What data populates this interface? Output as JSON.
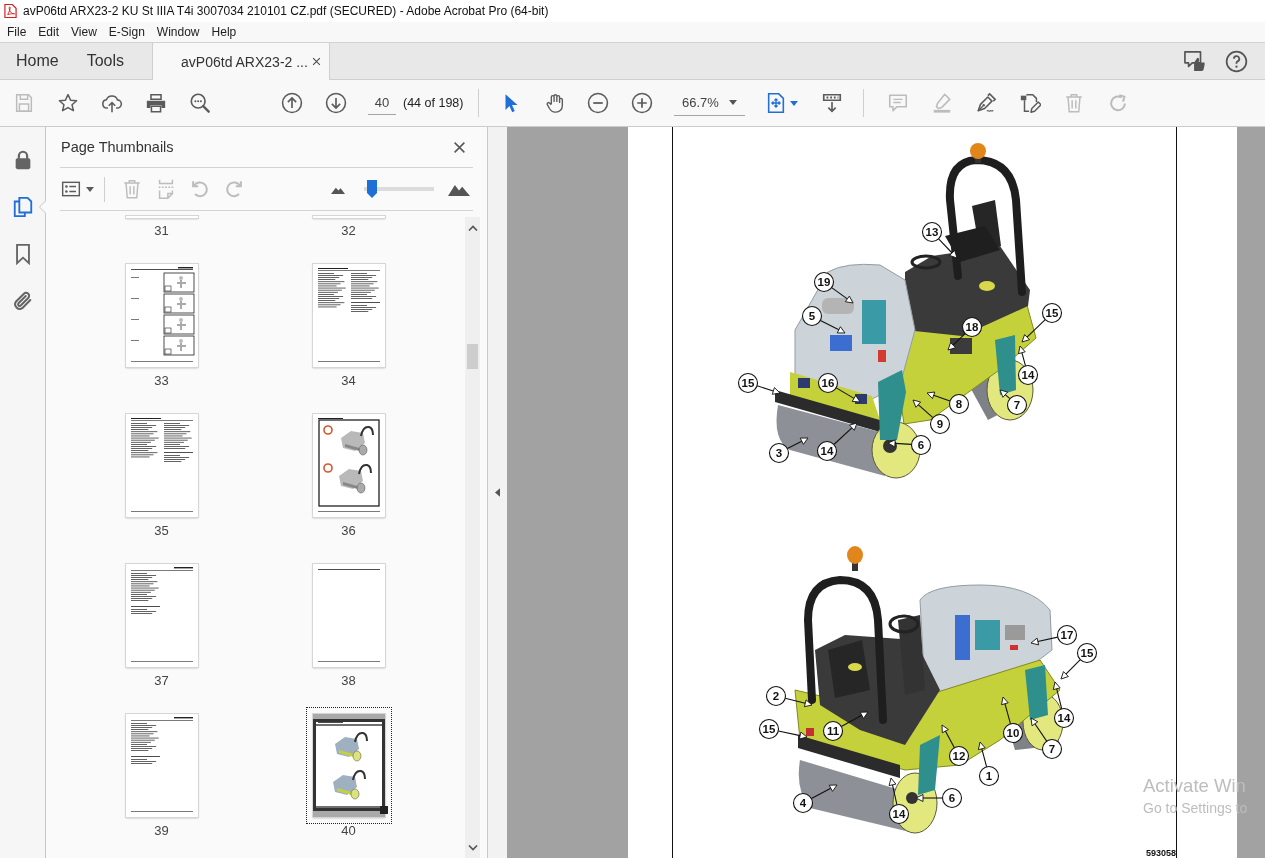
{
  "window": {
    "title": "avP06td ARX23-2 KU St IIIA T4i 3007034 210101 CZ.pdf (SECURED) - Adobe Acrobat Pro (64-bit)"
  },
  "menu": [
    "File",
    "Edit",
    "View",
    "E-Sign",
    "Window",
    "Help"
  ],
  "tabs": [
    {
      "label": "Home",
      "kind": "section",
      "selected": false
    },
    {
      "label": "Tools",
      "kind": "section",
      "selected": false
    },
    {
      "label": "avP06td ARX23-2 ...",
      "kind": "document",
      "selected": true
    }
  ],
  "toolbar": {
    "file_tools": [
      {
        "kind": "save",
        "disabled": true
      },
      {
        "kind": "star",
        "disabled": false
      },
      {
        "kind": "share",
        "disabled": false
      },
      {
        "kind": "print",
        "disabled": false
      },
      {
        "kind": "find",
        "disabled": false
      }
    ],
    "page_nav": [
      {
        "kind": "previous"
      },
      {
        "kind": "next"
      }
    ],
    "page_number": "40",
    "page_count": "(44 of 198)",
    "view_tools": [
      {
        "kind": "select",
        "selected": true
      },
      {
        "kind": "hand",
        "selected": false
      },
      {
        "kind": "zoom_out",
        "selected": false
      },
      {
        "kind": "zoom_in",
        "selected": false
      }
    ],
    "zoom": "66.7%",
    "page_tools": [
      {
        "kind": "organize",
        "selected": true
      },
      {
        "kind": "scroll",
        "selected": false
      }
    ],
    "edit_tools": [
      {
        "kind": "comment",
        "disabled": true
      },
      {
        "kind": "highlight",
        "disabled": true
      },
      {
        "kind": "sign",
        "disabled": false
      },
      {
        "kind": "edit",
        "disabled": false
      },
      {
        "kind": "delete",
        "disabled": true
      },
      {
        "kind": "rotate",
        "disabled": true
      }
    ]
  },
  "side_rail": [
    {
      "kind": "protect",
      "selected": false
    },
    {
      "kind": "pages",
      "selected": true
    },
    {
      "kind": "bookmarks",
      "selected": false
    },
    {
      "kind": "attachments",
      "selected": false
    }
  ],
  "thumbnails_panel": {
    "title": "Page Thumbnails",
    "tools": [
      {
        "kind": "options",
        "disabled": false
      },
      {
        "kind": "delete",
        "disabled": true
      },
      {
        "kind": "split",
        "disabled": true
      },
      {
        "kind": "rotate_left",
        "disabled": true
      },
      {
        "kind": "rotate_right",
        "disabled": true
      }
    ],
    "size_slider": {
      "level": 0.05
    },
    "pages": [
      {
        "label": "31",
        "kind": "cut",
        "selected": false
      },
      {
        "label": "32",
        "kind": "cut",
        "selected": false
      },
      {
        "label": "33",
        "kind": "signals",
        "selected": false
      },
      {
        "label": "34",
        "kind": "columns",
        "selected": false
      },
      {
        "label": "35",
        "kind": "columns",
        "selected": false
      },
      {
        "label": "36",
        "kind": "figure",
        "selected": false
      },
      {
        "label": "37",
        "kind": "text",
        "selected": false
      },
      {
        "label": "38",
        "kind": "blank",
        "selected": false
      },
      {
        "label": "39",
        "kind": "text",
        "selected": false
      },
      {
        "label": "40",
        "kind": "color_figure",
        "selected": true
      }
    ]
  },
  "document": {
    "figures": [
      {
        "callouts": [
          "13",
          "19",
          "5",
          "15",
          "18",
          "15",
          "16",
          "14",
          "8",
          "7",
          "9",
          "6",
          "14",
          "3"
        ]
      },
      {
        "callouts": [
          "17",
          "15",
          "2",
          "14",
          "15",
          "11",
          "10",
          "7",
          "12",
          "1",
          "6",
          "4",
          "14"
        ]
      }
    ],
    "figure_code": "593058"
  },
  "system_notice": {
    "title": "Activate Win",
    "hint": "Go to Settings to"
  }
}
